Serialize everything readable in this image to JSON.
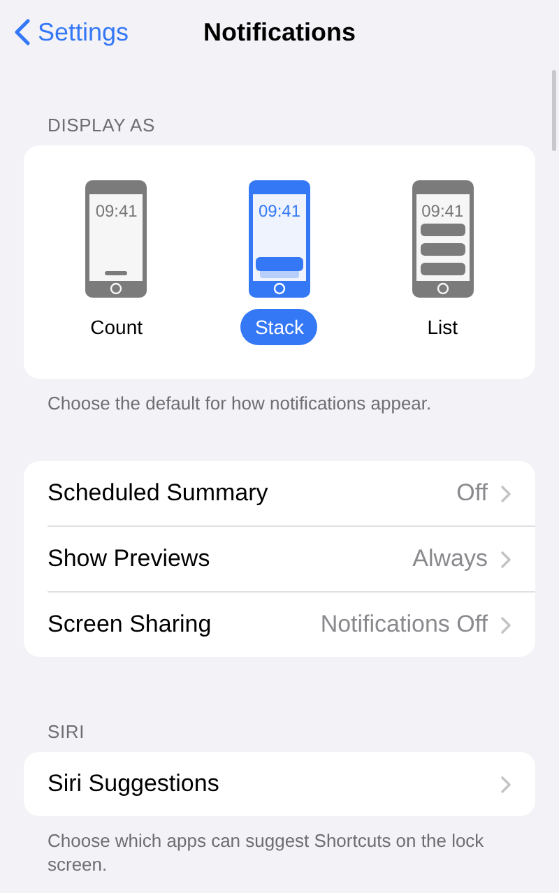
{
  "nav": {
    "back": "Settings",
    "title": "Notifications"
  },
  "display_as": {
    "header": "DISPLAY AS",
    "options": [
      {
        "kind": "count",
        "time": "09:41",
        "label": "Count",
        "selected": false
      },
      {
        "kind": "stack",
        "time": "09:41",
        "label": "Stack",
        "selected": true
      },
      {
        "kind": "list",
        "time": "09:41",
        "label": "List",
        "selected": false
      }
    ],
    "footer": "Choose the default for how notifications appear."
  },
  "settings": [
    {
      "label": "Scheduled Summary",
      "value": "Off"
    },
    {
      "label": "Show Previews",
      "value": "Always"
    },
    {
      "label": "Screen Sharing",
      "value": "Notifications Off"
    }
  ],
  "siri": {
    "header": "SIRI",
    "rows": [
      {
        "label": "Siri Suggestions"
      }
    ],
    "footer": "Choose which apps can suggest Shortcuts on the lock screen."
  }
}
